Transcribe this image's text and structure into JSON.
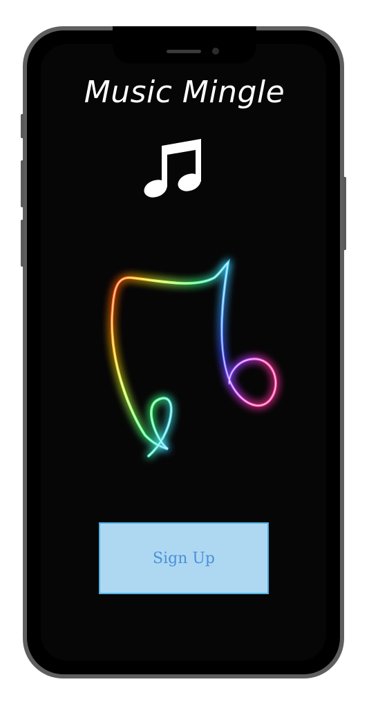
{
  "app": {
    "title": "Music Mingle"
  },
  "icons": {
    "logo": "music-note-icon",
    "art": "neon-music-note-icon"
  },
  "actions": {
    "signup_label": "Sign Up"
  },
  "colors": {
    "background": "#060606",
    "title": "#ffffff",
    "button_fill": "#aed8f2",
    "button_border": "#4fb3e6",
    "button_text": "#4a90d9"
  }
}
